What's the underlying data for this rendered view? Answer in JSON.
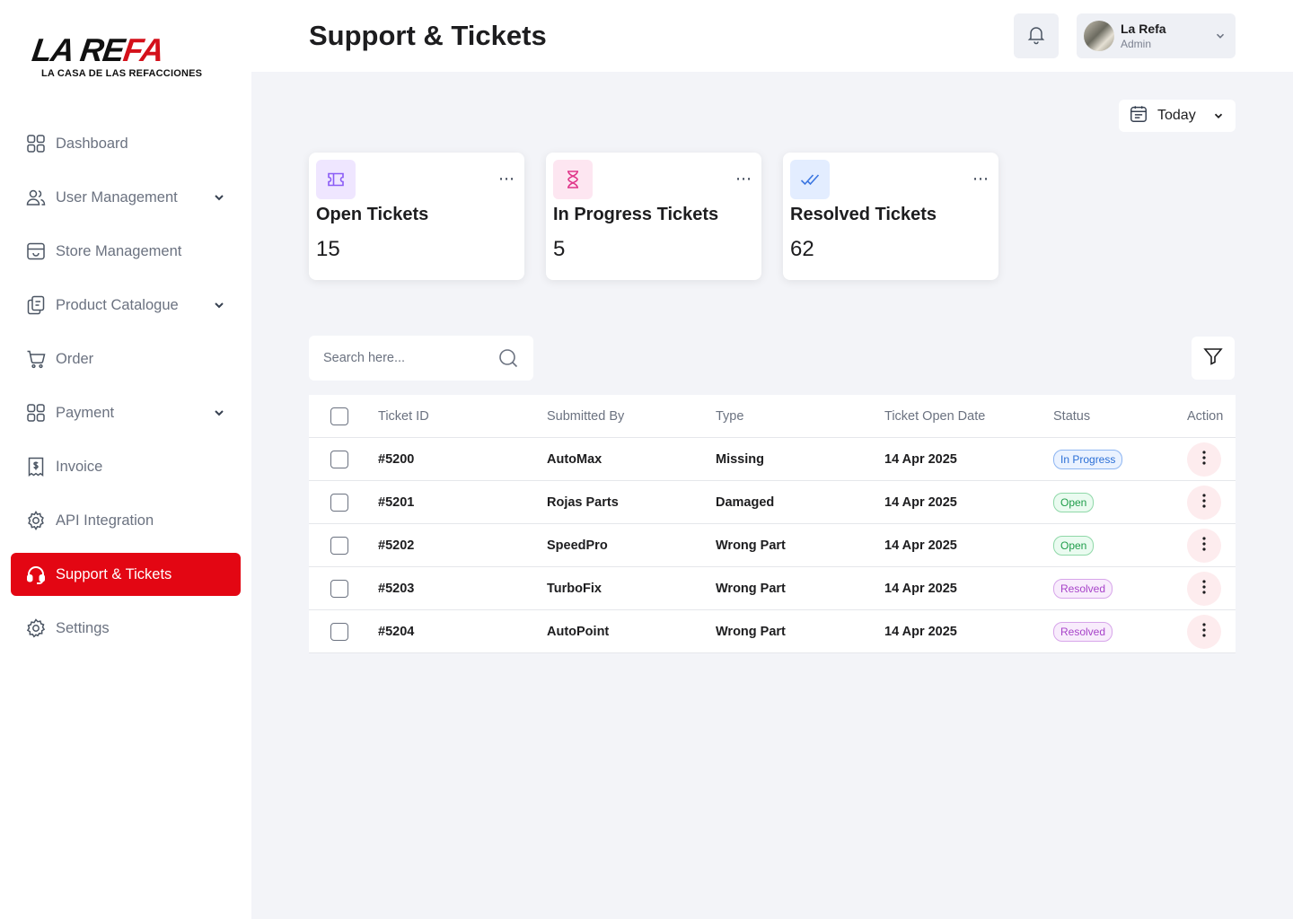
{
  "brand": {
    "logo_main_a": "LA RE",
    "logo_main_b": "FA",
    "logo_sub": "LA CASA DE LAS REFACCIONES"
  },
  "sidebar": {
    "items": [
      {
        "label": "Dashboard",
        "icon": "grid-icon",
        "has_chevron": false
      },
      {
        "label": "User Management",
        "icon": "users-icon",
        "has_chevron": true
      },
      {
        "label": "Store Management",
        "icon": "store-icon",
        "has_chevron": false
      },
      {
        "label": "Product Catalogue",
        "icon": "catalogue-icon",
        "has_chevron": true
      },
      {
        "label": "Order",
        "icon": "cart-icon",
        "has_chevron": false
      },
      {
        "label": "Payment",
        "icon": "grid-icon",
        "has_chevron": true
      },
      {
        "label": "Invoice",
        "icon": "invoice-icon",
        "has_chevron": false
      },
      {
        "label": "API Integration",
        "icon": "api-gear-icon",
        "has_chevron": false
      },
      {
        "label": "Support & Tickets",
        "icon": "headset-icon",
        "has_chevron": false,
        "active": true
      },
      {
        "label": "Settings",
        "icon": "gear-icon",
        "has_chevron": false
      }
    ],
    "active_color": "#e30613"
  },
  "header": {
    "title": "Support & Tickets",
    "profile": {
      "name": "La Refa",
      "role": "Admin"
    }
  },
  "date_filter": {
    "label": "Today"
  },
  "stats": [
    {
      "title": "Open Tickets",
      "value": "15",
      "icon": "ticket-icon",
      "icon_bg": "#efe6ff",
      "icon_color": "#8b5cf6"
    },
    {
      "title": "In Progress Tickets",
      "value": "5",
      "icon": "hourglass-icon",
      "icon_bg": "#fde6f1",
      "icon_color": "#e0368a"
    },
    {
      "title": "Resolved Tickets",
      "value": "62",
      "icon": "double-check-icon",
      "icon_bg": "#e3edff",
      "icon_color": "#3b76e1"
    }
  ],
  "search": {
    "placeholder": "Search here..."
  },
  "table": {
    "columns": [
      "Ticket ID",
      "Submitted By",
      "Type",
      "Ticket Open Date",
      "Status",
      "Action"
    ],
    "rows": [
      {
        "id": "#5200",
        "by": "AutoMax",
        "type": "Missing",
        "date": "14 Apr 2025",
        "status": "In Progress",
        "status_kind": "progress"
      },
      {
        "id": "#5201",
        "by": "Rojas Parts",
        "type": "Damaged",
        "date": "14 Apr 2025",
        "status": "Open",
        "status_kind": "open"
      },
      {
        "id": "#5202",
        "by": "SpeedPro",
        "type": "Wrong Part",
        "date": "14 Apr 2025",
        "status": "Open",
        "status_kind": "open"
      },
      {
        "id": "#5203",
        "by": "TurboFix",
        "type": "Wrong Part",
        "date": "14 Apr 2025",
        "status": "Resolved",
        "status_kind": "resolved"
      },
      {
        "id": "#5204",
        "by": "AutoPoint",
        "type": "Wrong Part",
        "date": "14 Apr 2025",
        "status": "Resolved",
        "status_kind": "resolved"
      }
    ]
  }
}
